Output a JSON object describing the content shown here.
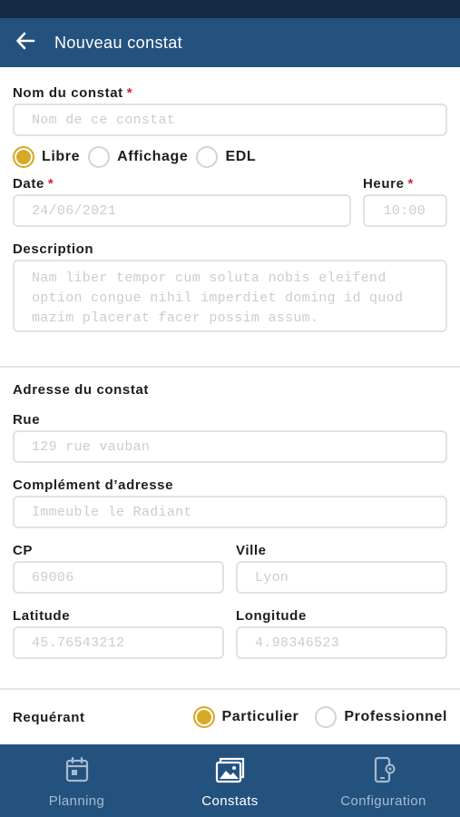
{
  "app_bar": {
    "title": "Nouveau constat",
    "back_icon": "arrow-left-icon"
  },
  "form": {
    "nom": {
      "label": "Nom du constat",
      "required_mark": "*",
      "placeholder": "Nom de ce constat"
    },
    "type_options": [
      {
        "label": "Libre",
        "checked": true
      },
      {
        "label": "Affichage",
        "checked": false
      },
      {
        "label": "EDL",
        "checked": false
      }
    ],
    "date": {
      "label": "Date",
      "required_mark": "*",
      "value": "24/06/2021"
    },
    "heure": {
      "label": "Heure",
      "required_mark": "*",
      "value": "10:00"
    },
    "description": {
      "label": "Description",
      "placeholder": "Nam liber tempor cum soluta nobis eleifend option congue nihil imperdiet doming id quod mazim placerat facer possim assum."
    }
  },
  "adresse": {
    "section_title": "Adresse du constat",
    "rue": {
      "label": "Rue",
      "placeholder": "129 rue vauban"
    },
    "complement": {
      "label": "Complément d’adresse",
      "placeholder": "Immeuble le Radiant"
    },
    "cp": {
      "label": "CP",
      "placeholder": "69006"
    },
    "ville": {
      "label": "Ville",
      "placeholder": "Lyon"
    },
    "latitude": {
      "label": "Latitude",
      "placeholder": "45.76543212"
    },
    "longitude": {
      "label": "Longitude",
      "placeholder": "4.98346523"
    }
  },
  "requerant": {
    "label": "Requérant",
    "options": [
      {
        "label": "Particulier",
        "checked": true
      },
      {
        "label": "Professionnel",
        "checked": false
      }
    ]
  },
  "bottom_nav": [
    {
      "label": "Planning",
      "icon": "calendar-icon",
      "active": false
    },
    {
      "label": "Constats",
      "icon": "photo-folder-icon",
      "active": true
    },
    {
      "label": "Configuration",
      "icon": "phone-settings-icon",
      "active": false
    }
  ],
  "colors": {
    "app_bar": "#24527e",
    "status_bar": "#152a44",
    "accent": "#d6aa26",
    "required": "#d0272e"
  }
}
